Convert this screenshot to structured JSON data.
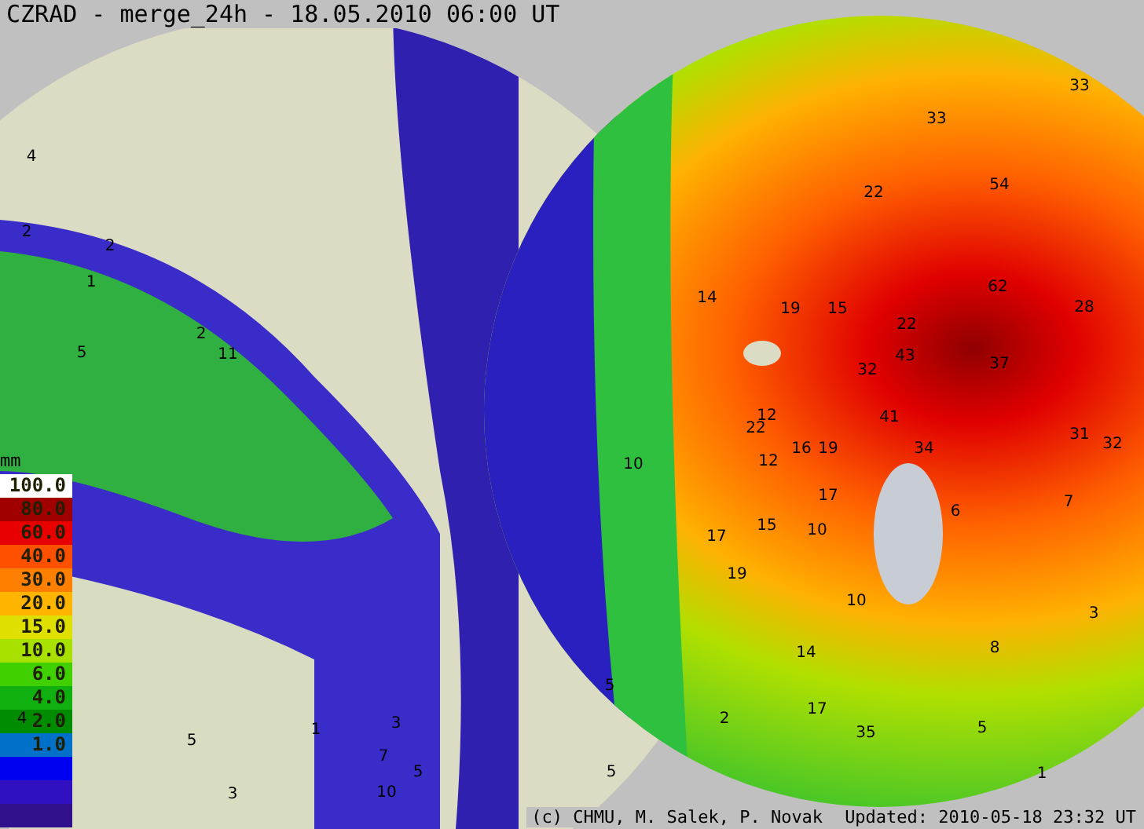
{
  "title": "CZRAD - merge_24h - 18.05.2010 06:00 UT",
  "legend": {
    "unit": "mm",
    "items": [
      {
        "label": "100.0",
        "color": "#ffffff"
      },
      {
        "label": "80.0",
        "color": "#a00000"
      },
      {
        "label": "60.0",
        "color": "#e80000"
      },
      {
        "label": "40.0",
        "color": "#ff5000"
      },
      {
        "label": "30.0",
        "color": "#ff8000"
      },
      {
        "label": "20.0",
        "color": "#ffb400"
      },
      {
        "label": "15.0",
        "color": "#e0e000"
      },
      {
        "label": "10.0",
        "color": "#a8e000"
      },
      {
        "label": "6.0",
        "color": "#40d000"
      },
      {
        "label": "4.0",
        "color": "#10b010"
      },
      {
        "label": "2.0",
        "color": "#008c00"
      },
      {
        "label": "1.0",
        "color": "#0070c8"
      },
      {
        "color": "#0000f0"
      },
      {
        "color": "#3010c0"
      },
      {
        "color": "#30108c"
      }
    ]
  },
  "map_values": [
    "33",
    "33",
    "4",
    "54",
    "22",
    "2",
    "2",
    "1",
    "62",
    "28",
    "5",
    "2",
    "11",
    "14",
    "19",
    "15",
    "22",
    "32",
    "43",
    "37",
    "41",
    "34",
    "31",
    "32",
    "12",
    "22",
    "16",
    "19",
    "12",
    "10",
    "17",
    "17",
    "15",
    "10",
    "19",
    "7",
    "6",
    "10",
    "8",
    "14",
    "17",
    "35",
    "5",
    "1",
    "3",
    "5",
    "10",
    "5",
    "7",
    "3",
    "1",
    "5",
    "5",
    "2",
    "3",
    "4"
  ],
  "credits": "(c) CHMU, M. Salek, P. Novak",
  "updated": "Updated: 2010-05-18 23:32 UT"
}
